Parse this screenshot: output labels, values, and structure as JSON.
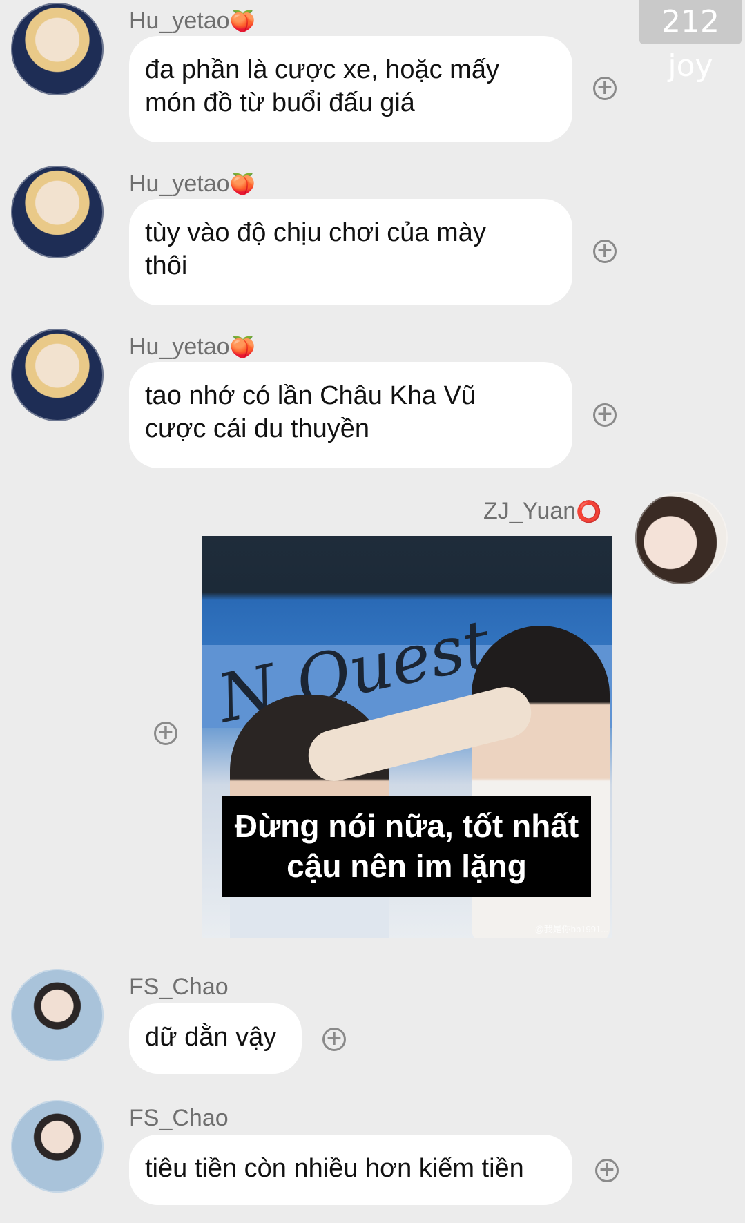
{
  "watermark": "212 joy",
  "messages": [
    {
      "sender": "Hu_yetao",
      "emoji": "🍑",
      "text_lines": [
        "đa phần là cược xe, hoặc mấy",
        "món đồ từ buổi đấu giá"
      ]
    },
    {
      "sender": "Hu_yetao",
      "emoji": "🍑",
      "text_lines": [
        "tùy vào độ chịu chơi của mày",
        "thôi"
      ]
    },
    {
      "sender": "Hu_yetao",
      "emoji": "🍑",
      "text_lines": [
        "tao nhớ có lần Châu Kha Vũ",
        "cược cái du thuyền"
      ]
    },
    {
      "sender": "ZJ_Yuan",
      "emoji": "⭕",
      "image": {
        "logo_text": "N Quest",
        "caption_lines": [
          "Đừng nói nữa, tốt nhất",
          "cậu nên im lặng"
        ],
        "credit": "@我是你bb1991..."
      }
    },
    {
      "sender": "FS_Chao",
      "text_lines": [
        "dữ dằn vậy"
      ]
    },
    {
      "sender": "FS_Chao",
      "text_lines": [
        "tiêu tiền còn nhiều hơn kiếm tiền"
      ]
    }
  ],
  "icons": {
    "reaction": "plus-circle-icon",
    "plus_glyph": "+"
  }
}
